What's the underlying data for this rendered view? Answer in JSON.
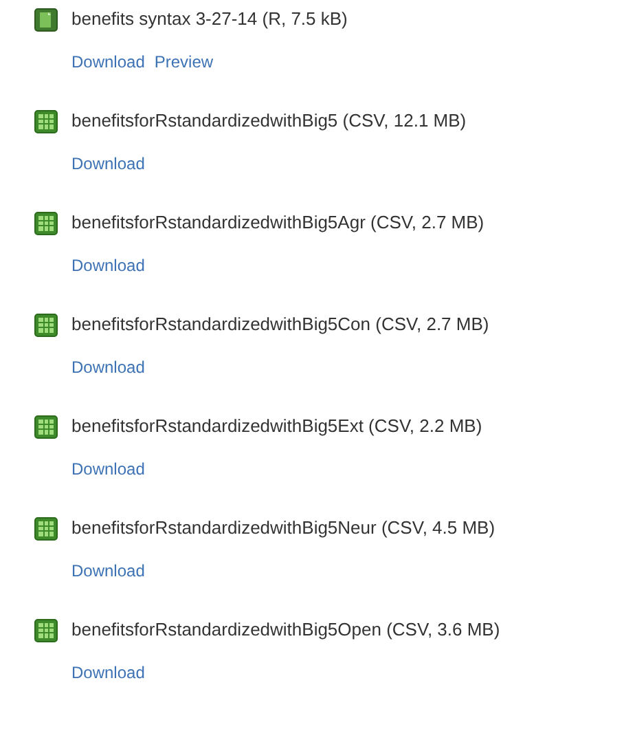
{
  "files": [
    {
      "kind": "r",
      "title": "benefits syntax 3-27-14 (R, 7.5 kB)",
      "links": [
        "Download",
        "Preview"
      ]
    },
    {
      "kind": "csv",
      "title": "benefitsforRstandardizedwithBig5 (CSV, 12.1 MB)",
      "links": [
        "Download"
      ]
    },
    {
      "kind": "csv",
      "title": "benefitsforRstandardizedwithBig5Agr (CSV, 2.7 MB)",
      "links": [
        "Download"
      ]
    },
    {
      "kind": "csv",
      "title": "benefitsforRstandardizedwithBig5Con (CSV, 2.7 MB)",
      "links": [
        "Download"
      ]
    },
    {
      "kind": "csv",
      "title": "benefitsforRstandardizedwithBig5Ext (CSV, 2.2 MB)",
      "links": [
        "Download"
      ]
    },
    {
      "kind": "csv",
      "title": "benefitsforRstandardizedwithBig5Neur (CSV, 4.5 MB)",
      "links": [
        "Download"
      ]
    },
    {
      "kind": "csv",
      "title": "benefitsforRstandardizedwithBig5Open (CSV, 3.6 MB)",
      "links": [
        "Download"
      ]
    }
  ]
}
